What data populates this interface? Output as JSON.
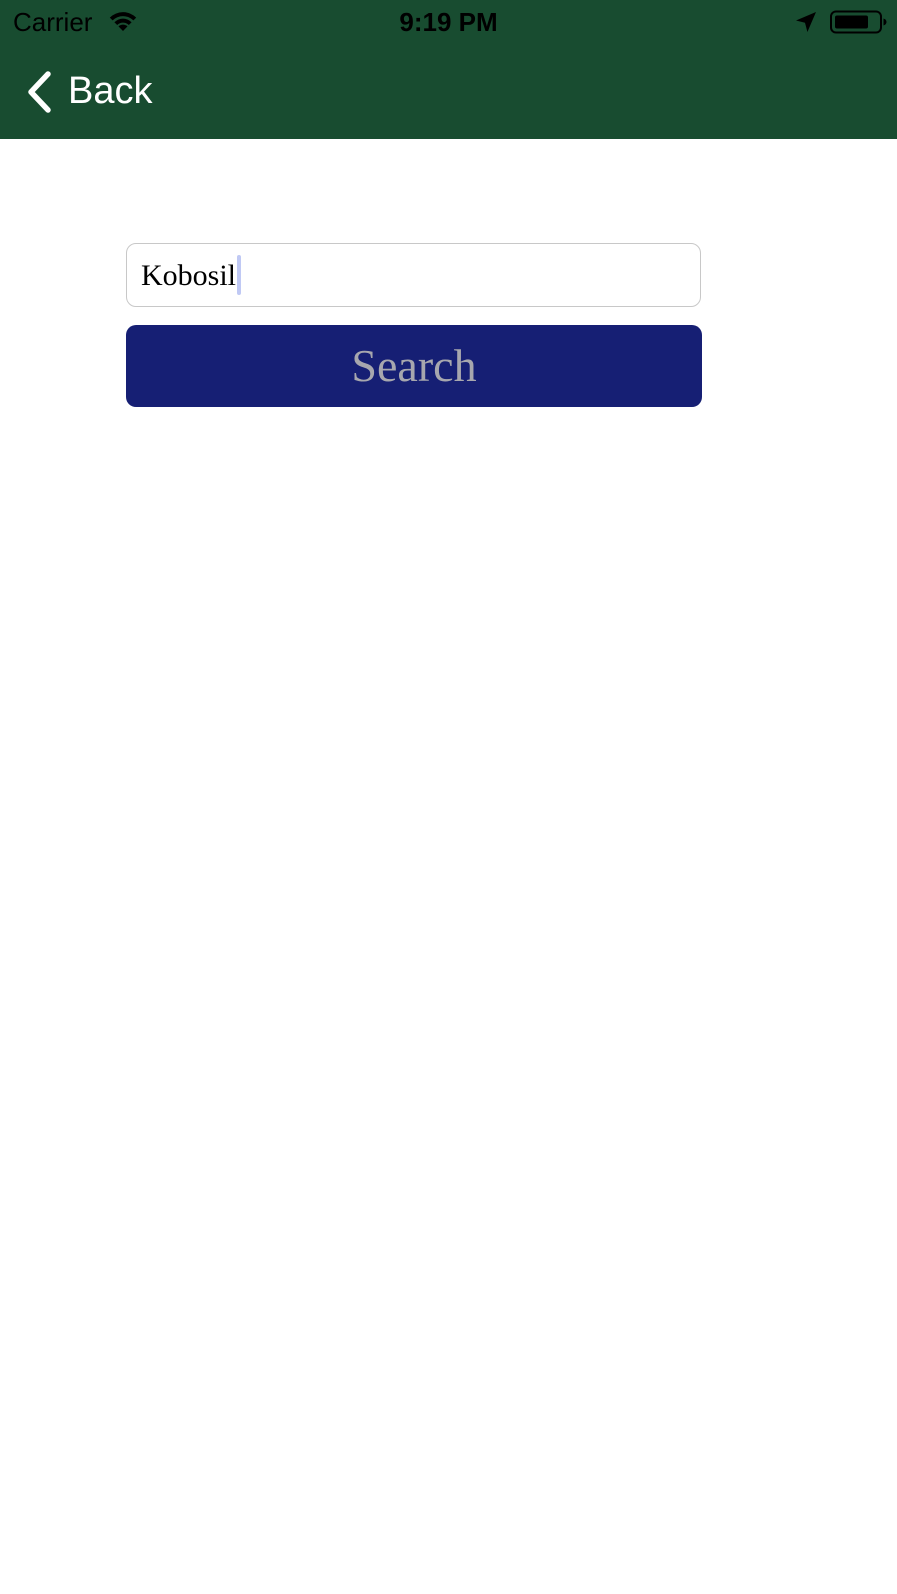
{
  "status_bar": {
    "carrier": "Carrier",
    "time": "9:19 PM",
    "wifi_icon": "wifi-icon",
    "location_icon": "location-arrow-icon",
    "battery_icon": "battery-icon"
  },
  "nav": {
    "back_label": "Back",
    "back_icon": "chevron-left-icon",
    "background_color": "#184c30"
  },
  "search": {
    "input_value": "Kobosil",
    "button_label": "Search",
    "button_color": "#161f74",
    "button_text_color": "#a7a7ae"
  }
}
